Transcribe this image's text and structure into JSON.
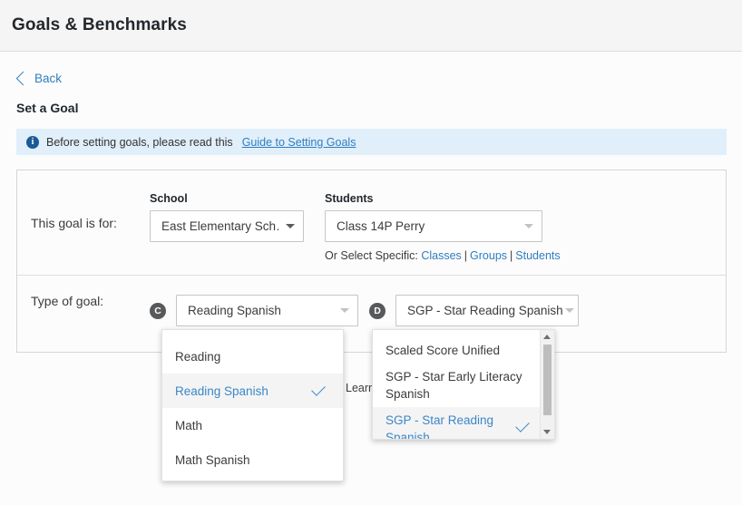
{
  "header": {
    "title": "Goals & Benchmarks"
  },
  "nav": {
    "back_label": "Back",
    "back_icon": "chevron-left-icon"
  },
  "page": {
    "section_title": "Set a Goal"
  },
  "banner": {
    "icon": "info-icon",
    "icon_glyph": "i",
    "text": "Before setting goals, please read this",
    "link_label": "Guide to Setting Goals"
  },
  "goal_for": {
    "row_label": "This goal is for:",
    "school": {
      "label": "School",
      "value": "East Elementary Sch…"
    },
    "students": {
      "label": "Students",
      "value": "Class 14P Perry",
      "or_select_prefix": "Or Select Specific:",
      "links": [
        "Classes",
        "Groups",
        "Students"
      ],
      "separator": "|"
    }
  },
  "goal_type": {
    "row_label": "Type of goal:",
    "badge_c": "C",
    "badge_d": "D",
    "subject": {
      "value": "Reading Spanish",
      "options": [
        {
          "label": "Reading",
          "selected": false
        },
        {
          "label": "Reading Spanish",
          "selected": true
        },
        {
          "label": "Math",
          "selected": false
        },
        {
          "label": "Math Spanish",
          "selected": false
        }
      ]
    },
    "measure": {
      "value": "SGP - Star Reading Spanish",
      "options": [
        {
          "label": "Scaled Score Unified",
          "selected": false
        },
        {
          "label": "SGP - Star Early Literacy Spanish",
          "selected": false
        },
        {
          "label": "SGP - Star Reading Spanish",
          "selected": true
        }
      ]
    },
    "obscured_text": "Learni"
  },
  "colors": {
    "link": "#2f7ec0",
    "selected_text": "#3b87c8",
    "banner_bg": "#e1effa",
    "badge_bg": "#58595b",
    "titlebar_bg": "#f5f5f5"
  }
}
